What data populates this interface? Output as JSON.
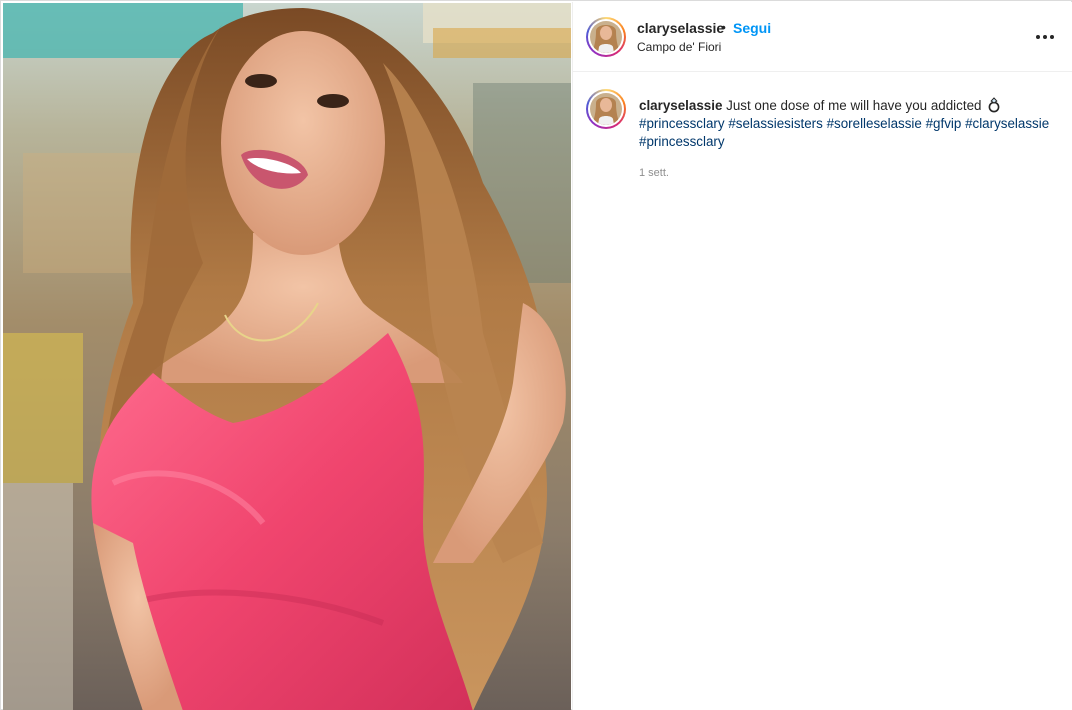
{
  "post": {
    "username": "claryselassie",
    "separator": "•",
    "follow_label": "Segui",
    "location": "Campo de' Fiori",
    "more_icon": "more-horizontal-icon"
  },
  "caption": {
    "username": "claryselassie",
    "text": "Just one dose of me will have you addicted",
    "emoji_icon": "ring-icon",
    "hashtags": [
      "#princessclary",
      "#selassiesisters",
      "#sorelleselassie",
      "#gfvip",
      "#claryselassie",
      "#princessclary"
    ],
    "time": "1 sett."
  },
  "colors": {
    "follow_blue": "#0095f6",
    "hashtag_blue": "#00376b",
    "dress_pink": "#f0456e",
    "muted_gray": "#8e8e8e"
  }
}
